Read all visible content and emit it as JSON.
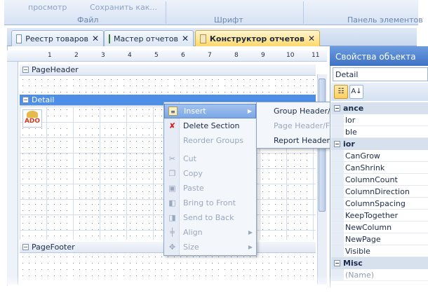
{
  "ribbon": {
    "top_items": [
      "просмотр",
      "Сохранить как..."
    ],
    "groups": [
      "Файл",
      "Шрифт",
      "Панель элементов"
    ]
  },
  "tabs": [
    {
      "label": "Реестр товаров",
      "close": "✕",
      "icon": "table-icon"
    },
    {
      "label": "Мастер отчетов",
      "close": "✕",
      "icon": "wizard-icon"
    },
    {
      "label": "Конструктор отчетов",
      "close": "✕",
      "icon": "designer-icon",
      "active": true
    }
  ],
  "ruler": {
    "marks": [
      "1",
      "2",
      "3",
      "4",
      "5",
      "6",
      "7",
      "8",
      "9",
      "10",
      "11"
    ]
  },
  "sections": {
    "page_header": "PageHeader",
    "detail": "Detail",
    "page_footer": "PageFooter"
  },
  "ado_label": "ADO",
  "context_menu": {
    "items": [
      {
        "label": "Insert",
        "icon": "insert-icon",
        "enabled": true,
        "highlighted": true,
        "submenu": true
      },
      {
        "label": "Delete Section",
        "icon": "delete-icon",
        "enabled": true
      },
      {
        "label": "Reorder Groups",
        "icon": "",
        "enabled": false
      },
      {
        "label": "Cut",
        "icon": "cut-icon",
        "enabled": false
      },
      {
        "label": "Copy",
        "icon": "copy-icon",
        "enabled": false
      },
      {
        "label": "Paste",
        "icon": "paste-icon",
        "enabled": false
      },
      {
        "label": "Bring to Front",
        "icon": "bring-front-icon",
        "enabled": false
      },
      {
        "label": "Send to Back",
        "icon": "send-back-icon",
        "enabled": false
      },
      {
        "label": "Align",
        "icon": "align-icon",
        "enabled": false,
        "submenu": true
      },
      {
        "label": "Size",
        "icon": "size-icon",
        "enabled": false,
        "submenu": true
      }
    ]
  },
  "insert_submenu": {
    "items": [
      {
        "label": "Group Header/Footer",
        "enabled": true
      },
      {
        "label": "Page Header/Footer",
        "enabled": false
      },
      {
        "label": "Report Header/Footer",
        "enabled": true
      }
    ]
  },
  "properties": {
    "title": "Свойства объекта",
    "selected_object": "Detail",
    "categories": {
      "appearance": "ance",
      "behavior": "ior",
      "misc": "Misc"
    },
    "rows_top": [
      "lor",
      "ble"
    ],
    "rows": [
      "CanGrow",
      "CanShrink",
      "ColumnCount",
      "ColumnDirection",
      "ColumnSpacing",
      "KeepTogether",
      "NewColumn",
      "NewPage",
      "Visible"
    ],
    "misc_row": "(Name)"
  },
  "colors": {
    "accent": "#4d8ee6",
    "title_bar": "#3f72c4",
    "active_tab": "#ffd86b",
    "ado_text": "#d33b1d"
  }
}
